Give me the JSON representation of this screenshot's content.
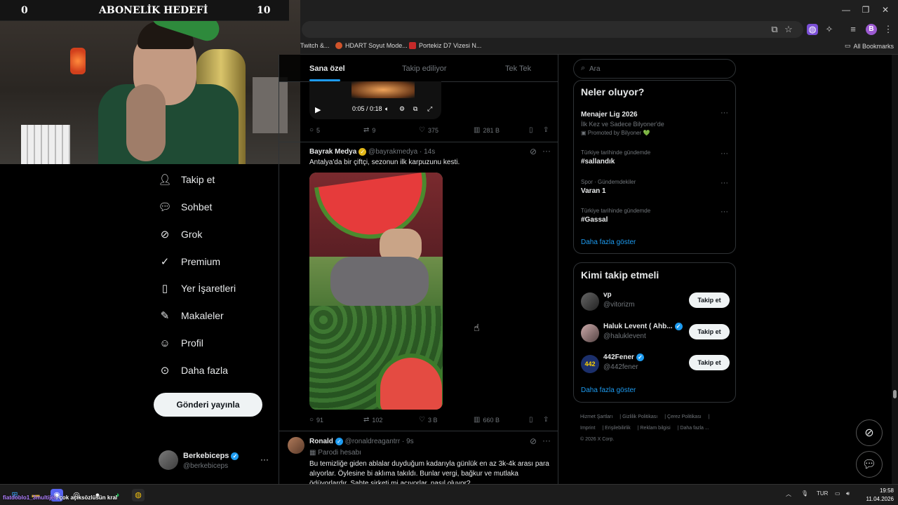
{
  "webcam": {
    "goal_title": "ABONELİK HEDEFİ",
    "goal_current": "0",
    "goal_target": "10"
  },
  "bookmarks": [
    {
      "label": "Twitch &..."
    },
    {
      "label": "HDART Soyut Mode..."
    },
    {
      "label": "Portekiz D7 Vizesi N..."
    },
    {
      "label": "All Bookmarks"
    }
  ],
  "nav": {
    "items": [
      {
        "label": "Takip et",
        "icon": "person-add-icon"
      },
      {
        "label": "Sohbet",
        "icon": "chat-icon"
      },
      {
        "label": "Grok",
        "icon": "grok-icon"
      },
      {
        "label": "Premium",
        "icon": "verified-badge-icon"
      },
      {
        "label": "Yer İşaretleri",
        "icon": "bookmark-icon"
      },
      {
        "label": "Makaleler",
        "icon": "article-icon"
      },
      {
        "label": "Profil",
        "icon": "person-icon"
      },
      {
        "label": "Daha fazla",
        "icon": "more-circle-icon"
      }
    ],
    "post_button": "Gönderi yayınla",
    "account": {
      "name": "Berkebiceps",
      "handle": "@berkebiceps"
    }
  },
  "timeline": {
    "tabs": [
      {
        "label": "Sana özel",
        "active": true
      },
      {
        "label": "Takip ediliyor",
        "active": false
      },
      {
        "label": "Tek Tek",
        "active": false
      }
    ],
    "video": {
      "time": "0:05 / 0:18"
    },
    "tweet1_stats": {
      "replies": "5",
      "retweets": "9",
      "likes": "375",
      "views": "281 B"
    },
    "tweet2": {
      "author": "Bayrak Medya",
      "handle": "@bayrakmedya",
      "time": "· 14s",
      "text": "Antalya'da bir çiftçi, sezonun ilk karpuzunu kesti.",
      "stats": {
        "replies": "91",
        "retweets": "102",
        "likes": "3 B",
        "views": "660 B"
      }
    },
    "tweet3": {
      "author": "Ronald",
      "handle": "@ronaldreagantrr",
      "time": "· 9s",
      "label": "Parodi hesabı",
      "text": "Bu temizliğe giden ablalar duyduğum kadarıyla günlük en az 3k-4k arası para alıyorlar. Öylesine bi aklıma takıldı. Bunlar vergi, bağkur ve mutlaka ödüyorlardır. Sahte şirketi mi açıyorlar, nasıl oluyor?"
    }
  },
  "sidebar": {
    "search_placeholder": "Ara",
    "trends_title": "Neler oluyor?",
    "trends": [
      {
        "meta": "",
        "name": "Menajer Lig 2026",
        "sub": "İlk Kez ve Sadece Bilyoner'de",
        "promo": "Promoted by Bilyoner 💚"
      },
      {
        "meta": "Türkiye tarihinde gündemde",
        "name": "#sallandık",
        "sub": "",
        "promo": ""
      },
      {
        "meta": "Spor · Gündemdekiler",
        "name": "Varan 1",
        "sub": "",
        "promo": ""
      },
      {
        "meta": "Türkiye tarihinde gündemde",
        "name": "#Gassal",
        "sub": "",
        "promo": ""
      }
    ],
    "trends_more": "Daha fazla göster",
    "who_title": "Kimi takip etmeli",
    "who": [
      {
        "name": "vp",
        "handle": "@vitorizm",
        "button": "Takip et"
      },
      {
        "name": "Haluk Levent ( Ahb...",
        "handle": "@haluklevent",
        "button": "Takip et"
      },
      {
        "name": "442Fener",
        "handle": "@442fener",
        "button": "Takip et"
      }
    ],
    "who_more": "Daha fazla göster",
    "footer": [
      "Hizmet Şartları",
      "Gizlilik Politikası",
      "Çerez Politikası",
      "Imprint",
      "Erişilebilirlik",
      "Reklam bilgisi",
      "Daha fazla ...",
      "© 2026 X Corp."
    ]
  },
  "taskbar": {
    "chat_user": "fiatdoblo1_3multijet",
    "chat_msg": ": çok açıksözlüsün kral",
    "lang": "TUR",
    "time": "19:58",
    "date": "11.04.2026"
  }
}
